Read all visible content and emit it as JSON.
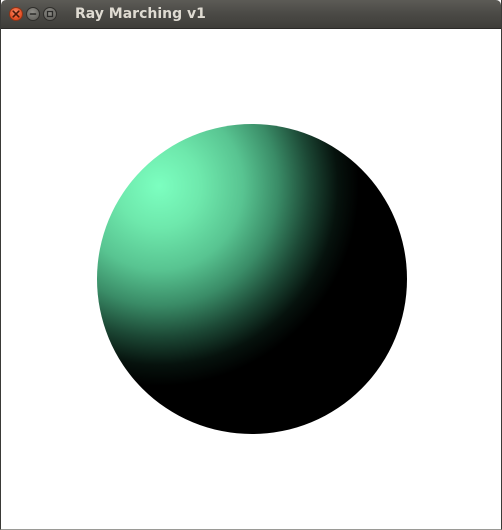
{
  "window": {
    "title": "Ray Marching v1",
    "controls": {
      "close_icon": "close-icon",
      "minimize_icon": "minimize-icon",
      "maximize_icon": "maximize-icon"
    }
  },
  "scene": {
    "background_color": "#ffffff",
    "object": "sphere",
    "sphere_highlight_color": "#7cffc0",
    "sphere_shadow_color": "#000000"
  }
}
